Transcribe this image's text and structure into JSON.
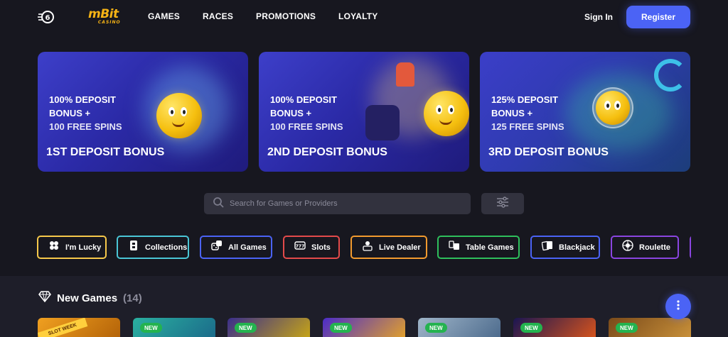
{
  "header": {
    "logo_main": "mBit",
    "logo_sub": "CASINO",
    "nav": [
      "GAMES",
      "RACES",
      "PROMOTIONS",
      "LOYALTY"
    ],
    "signin_label": "Sign In",
    "register_label": "Register",
    "accent_color": "#4b63f5",
    "logo_color": "#f6b315"
  },
  "banners": [
    {
      "line1": "100% DEPOSIT",
      "line2": "BONUS +",
      "line3": "100 FREE SPINS",
      "title": "1ST DEPOSIT BONUS"
    },
    {
      "line1": "100% DEPOSIT",
      "line2": "BONUS +",
      "line3": "100 FREE SPINS",
      "title": "2ND DEPOSIT BONUS"
    },
    {
      "line1": "125% DEPOSIT",
      "line2": "BONUS +",
      "line3": "125 FREE SPINS",
      "title": "3RD DEPOSIT BONUS"
    }
  ],
  "search": {
    "placeholder": "Search for Games or Providers",
    "icon": "search-icon"
  },
  "filter": {
    "icon": "sliders-icon"
  },
  "categories": [
    {
      "label": "I'm Lucky",
      "icon": "clover-icon",
      "color": "#f6c84a"
    },
    {
      "label": "Collections",
      "icon": "collection-icon",
      "color": "#4ac6d6"
    },
    {
      "label": "All Games",
      "icon": "dice-icon",
      "color": "#4b63f5"
    },
    {
      "label": "Slots",
      "icon": "slots-icon",
      "color": "#e34a4a"
    },
    {
      "label": "Live Dealer",
      "icon": "live-dealer-icon",
      "color": "#f29a2e"
    },
    {
      "label": "Table Games",
      "icon": "table-games-icon",
      "color": "#2ebf5c"
    },
    {
      "label": "Blackjack",
      "icon": "cards-icon",
      "color": "#4b63f5"
    },
    {
      "label": "Roulette",
      "icon": "roulette-icon",
      "color": "#8a45e0"
    }
  ],
  "new_games": {
    "title": "New Games",
    "count": "(14)",
    "badge": "NEW",
    "slot_week_label": "SLOT WEEK"
  }
}
